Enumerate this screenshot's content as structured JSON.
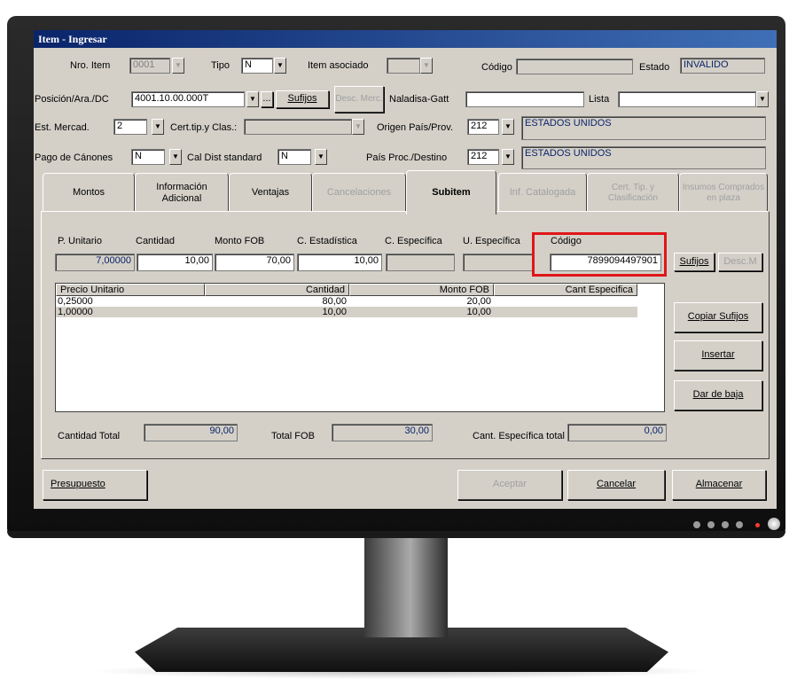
{
  "window": {
    "title": "Item - Ingresar"
  },
  "row1": {
    "nro_item_label": "Nro. Item",
    "nro_item_value": "0001",
    "tipo_label": "Tipo",
    "tipo_value": "N",
    "item_asociado_label": "Item asociado",
    "codigo_label": "Código",
    "codigo_value": "",
    "estado_label": "Estado",
    "estado_value": "INVALIDO"
  },
  "row2": {
    "posicion_label": "Posición/Ara./DC",
    "posicion_value": "4001.10.00.000T",
    "ellipsis_label": "...",
    "sufijos_label": "Sufijos",
    "desc_merc_label": "Desc. Merc.",
    "naladisa_label": "Naladisa-Gatt",
    "naladisa_value": "",
    "lista_label": "Lista",
    "lista_value": ""
  },
  "row3": {
    "est_mercad_label": "Est. Mercad.",
    "est_mercad_value": "2",
    "cert_label": "Cert.tip.y Clas.:",
    "cert_value": "",
    "origen_label": "Origen País/Prov.",
    "origen_code": "212",
    "origen_name": "ESTADOS UNIDOS"
  },
  "row4": {
    "pago_label": "Pago de Cánones",
    "pago_value": "N",
    "cal_dist_label": "Cal Dist standard",
    "cal_dist_value": "N",
    "pais_proc_label": "País Proc./Destino",
    "pais_proc_code": "212",
    "pais_proc_name": "ESTADOS UNIDOS"
  },
  "tabs": [
    {
      "label": "Montos"
    },
    {
      "label": "Información Adicional"
    },
    {
      "label": "Ventajas"
    },
    {
      "label": "Cancelaciones"
    },
    {
      "label": "Subitem"
    },
    {
      "label": "Inf. Catalogada"
    },
    {
      "label": "Cert. Tip. y Clasificación"
    },
    {
      "label": "Insumos Comprados en plaza"
    }
  ],
  "subitem": {
    "p_unitario_label": "P. Unitario",
    "p_unitario_value": "7,00000",
    "cantidad_label": "Cantidad",
    "cantidad_value": "10,00",
    "monto_fob_label": "Monto FOB",
    "monto_fob_value": "70,00",
    "c_estadistica_label": "C. Estadística",
    "c_estadistica_value": "10,00",
    "c_especifica_label": "C. Específica",
    "c_especifica_value": "",
    "u_especifica_label": "U. Específica",
    "u_especifica_value": "",
    "codigo_label": "Código",
    "codigo_value": "7899094497901",
    "sufijos_label": "Sufijos",
    "desc_m_label": "Desc.M"
  },
  "grid": {
    "headers": [
      "Precio Unitario",
      "Cantidad",
      "Monto FOB",
      "Cant Especifica"
    ],
    "rows": [
      [
        "0,25000",
        "80,00",
        "20,00",
        ""
      ],
      [
        "1,00000",
        "10,00",
        "10,00",
        ""
      ]
    ]
  },
  "side_buttons": {
    "copiar": "Copiar Sufijos",
    "insertar": "Insertar",
    "dar_baja": "Dar de baja"
  },
  "totals": {
    "cantidad_total_label": "Cantidad Total",
    "cantidad_total_value": "90,00",
    "total_fob_label": "Total FOB",
    "total_fob_value": "30,00",
    "cant_esp_label": "Cant. Específica total",
    "cant_esp_value": "0,00"
  },
  "bottom_buttons": {
    "presupuesto": "Presupuesto",
    "aceptar": "Aceptar",
    "cancelar": "Cancelar",
    "almacenar": "Almacenar"
  },
  "colors": {
    "highlight": "#e0161a",
    "titlebar": "#0a246a",
    "face": "#d4d0c8"
  }
}
